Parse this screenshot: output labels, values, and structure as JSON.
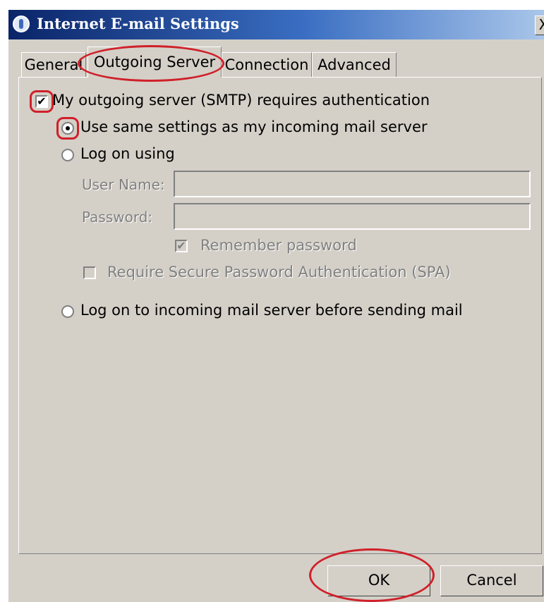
{
  "window": {
    "title": "Internet E-mail Settings",
    "close_label": "X"
  },
  "tabs": [
    {
      "label": "General",
      "active": false
    },
    {
      "label": "Outgoing Server",
      "active": true
    },
    {
      "label": "Connection",
      "active": false
    },
    {
      "label": "Advanced",
      "active": false
    }
  ],
  "outgoing": {
    "requires_auth_label": "My outgoing server (SMTP) requires authentication",
    "requires_auth_checked": true,
    "same_settings_label": "Use same settings as my incoming mail server",
    "logon_using_label": "Log on using",
    "username_label": "User Name:",
    "username_value": "",
    "password_label": "Password:",
    "password_value": "",
    "remember_password_label": "Remember password",
    "remember_password_checked": true,
    "spa_label": "Require Secure Password Authentication (SPA)",
    "spa_checked": false,
    "logon_before_sending_label": "Log on to incoming mail server before sending mail"
  },
  "buttons": {
    "ok_label": "OK",
    "cancel_label": "Cancel"
  },
  "colors": {
    "dialog_bg": "#d4d0c8",
    "highlight": "#d0202a",
    "disabled_text": "#808080"
  }
}
